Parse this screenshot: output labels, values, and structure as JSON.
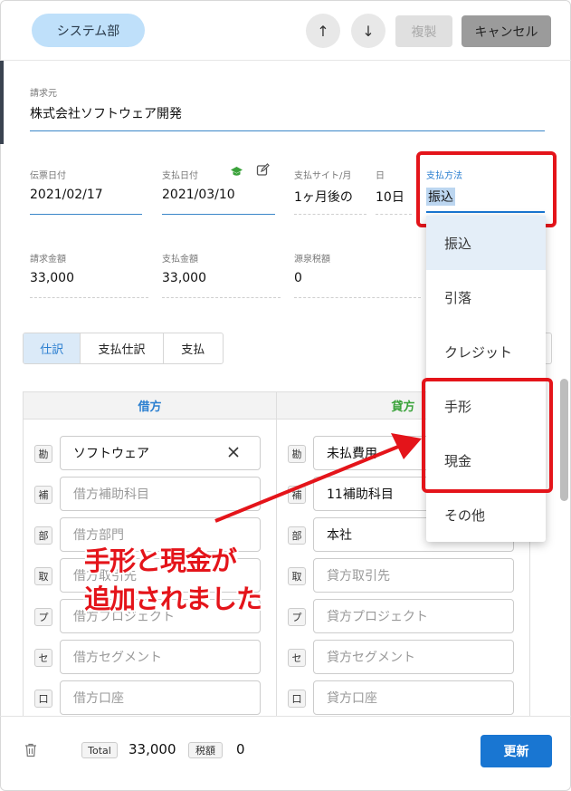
{
  "header": {
    "department": "システム部",
    "up_icon": "↑",
    "down_icon": "↓",
    "copy_label": "複製",
    "cancel_label": "キャンセル"
  },
  "vendor": {
    "label": "請求元",
    "value": "株式会社ソフトウェア開発"
  },
  "dates": {
    "invoice_date_label": "伝票日付",
    "invoice_date": "2021/02/17",
    "payment_date_label": "支払日付",
    "payment_date": "2021/03/10",
    "payment_site_label": "支払サイト/月",
    "payment_site": "1ヶ月後の",
    "day_label": "日",
    "day": "10日",
    "method_label": "支払方法",
    "method": "振込"
  },
  "amounts": {
    "invoice_label": "請求金額",
    "invoice": "33,000",
    "payment_label": "支払金額",
    "payment": "33,000",
    "withholding_label": "源泉税額",
    "withholding": "0"
  },
  "tabs": [
    {
      "label": "仕訳"
    },
    {
      "label": "支払仕訳"
    },
    {
      "label": "支払"
    }
  ],
  "debit": {
    "header": "借方",
    "header_color": "#2b7fd0",
    "rows": [
      {
        "badge": "勘",
        "value": "ソフトウェア",
        "placeholder": ""
      },
      {
        "badge": "補",
        "value": "",
        "placeholder": "借方補助科目"
      },
      {
        "badge": "部",
        "value": "",
        "placeholder": "借方部門"
      },
      {
        "badge": "取",
        "value": "",
        "placeholder": "借方取引先"
      },
      {
        "badge": "プ",
        "value": "",
        "placeholder": "借方プロジェクト"
      },
      {
        "badge": "セ",
        "value": "",
        "placeholder": "借方セグメント"
      },
      {
        "badge": "口",
        "value": "",
        "placeholder": "借方口座"
      }
    ]
  },
  "credit": {
    "header": "貸方",
    "header_color": "#3aa23a",
    "rows": [
      {
        "badge": "勘",
        "value": "未払費用",
        "placeholder": ""
      },
      {
        "badge": "補",
        "value": "11補助科目",
        "placeholder": ""
      },
      {
        "badge": "部",
        "value": "本社",
        "placeholder": ""
      },
      {
        "badge": "取",
        "value": "",
        "placeholder": "貸方取引先"
      },
      {
        "badge": "プ",
        "value": "",
        "placeholder": "貸方プロジェクト"
      },
      {
        "badge": "セ",
        "value": "",
        "placeholder": "貸方セグメント"
      },
      {
        "badge": "口",
        "value": "",
        "placeholder": "貸方口座"
      }
    ]
  },
  "dropdown": {
    "options": [
      {
        "label": "振込",
        "selected": true
      },
      {
        "label": "引落"
      },
      {
        "label": "クレジット"
      },
      {
        "label": "手形"
      },
      {
        "label": "現金"
      },
      {
        "label": "その他"
      }
    ]
  },
  "annotation": {
    "line1": "手形と現金が",
    "line2": "追加されました",
    "color": "#e4141a"
  },
  "footer": {
    "total_tag": "Total",
    "total": "33,000",
    "tax_tag": "税額",
    "tax": "0",
    "update_label": "更新",
    "accent": "#1976d2"
  }
}
